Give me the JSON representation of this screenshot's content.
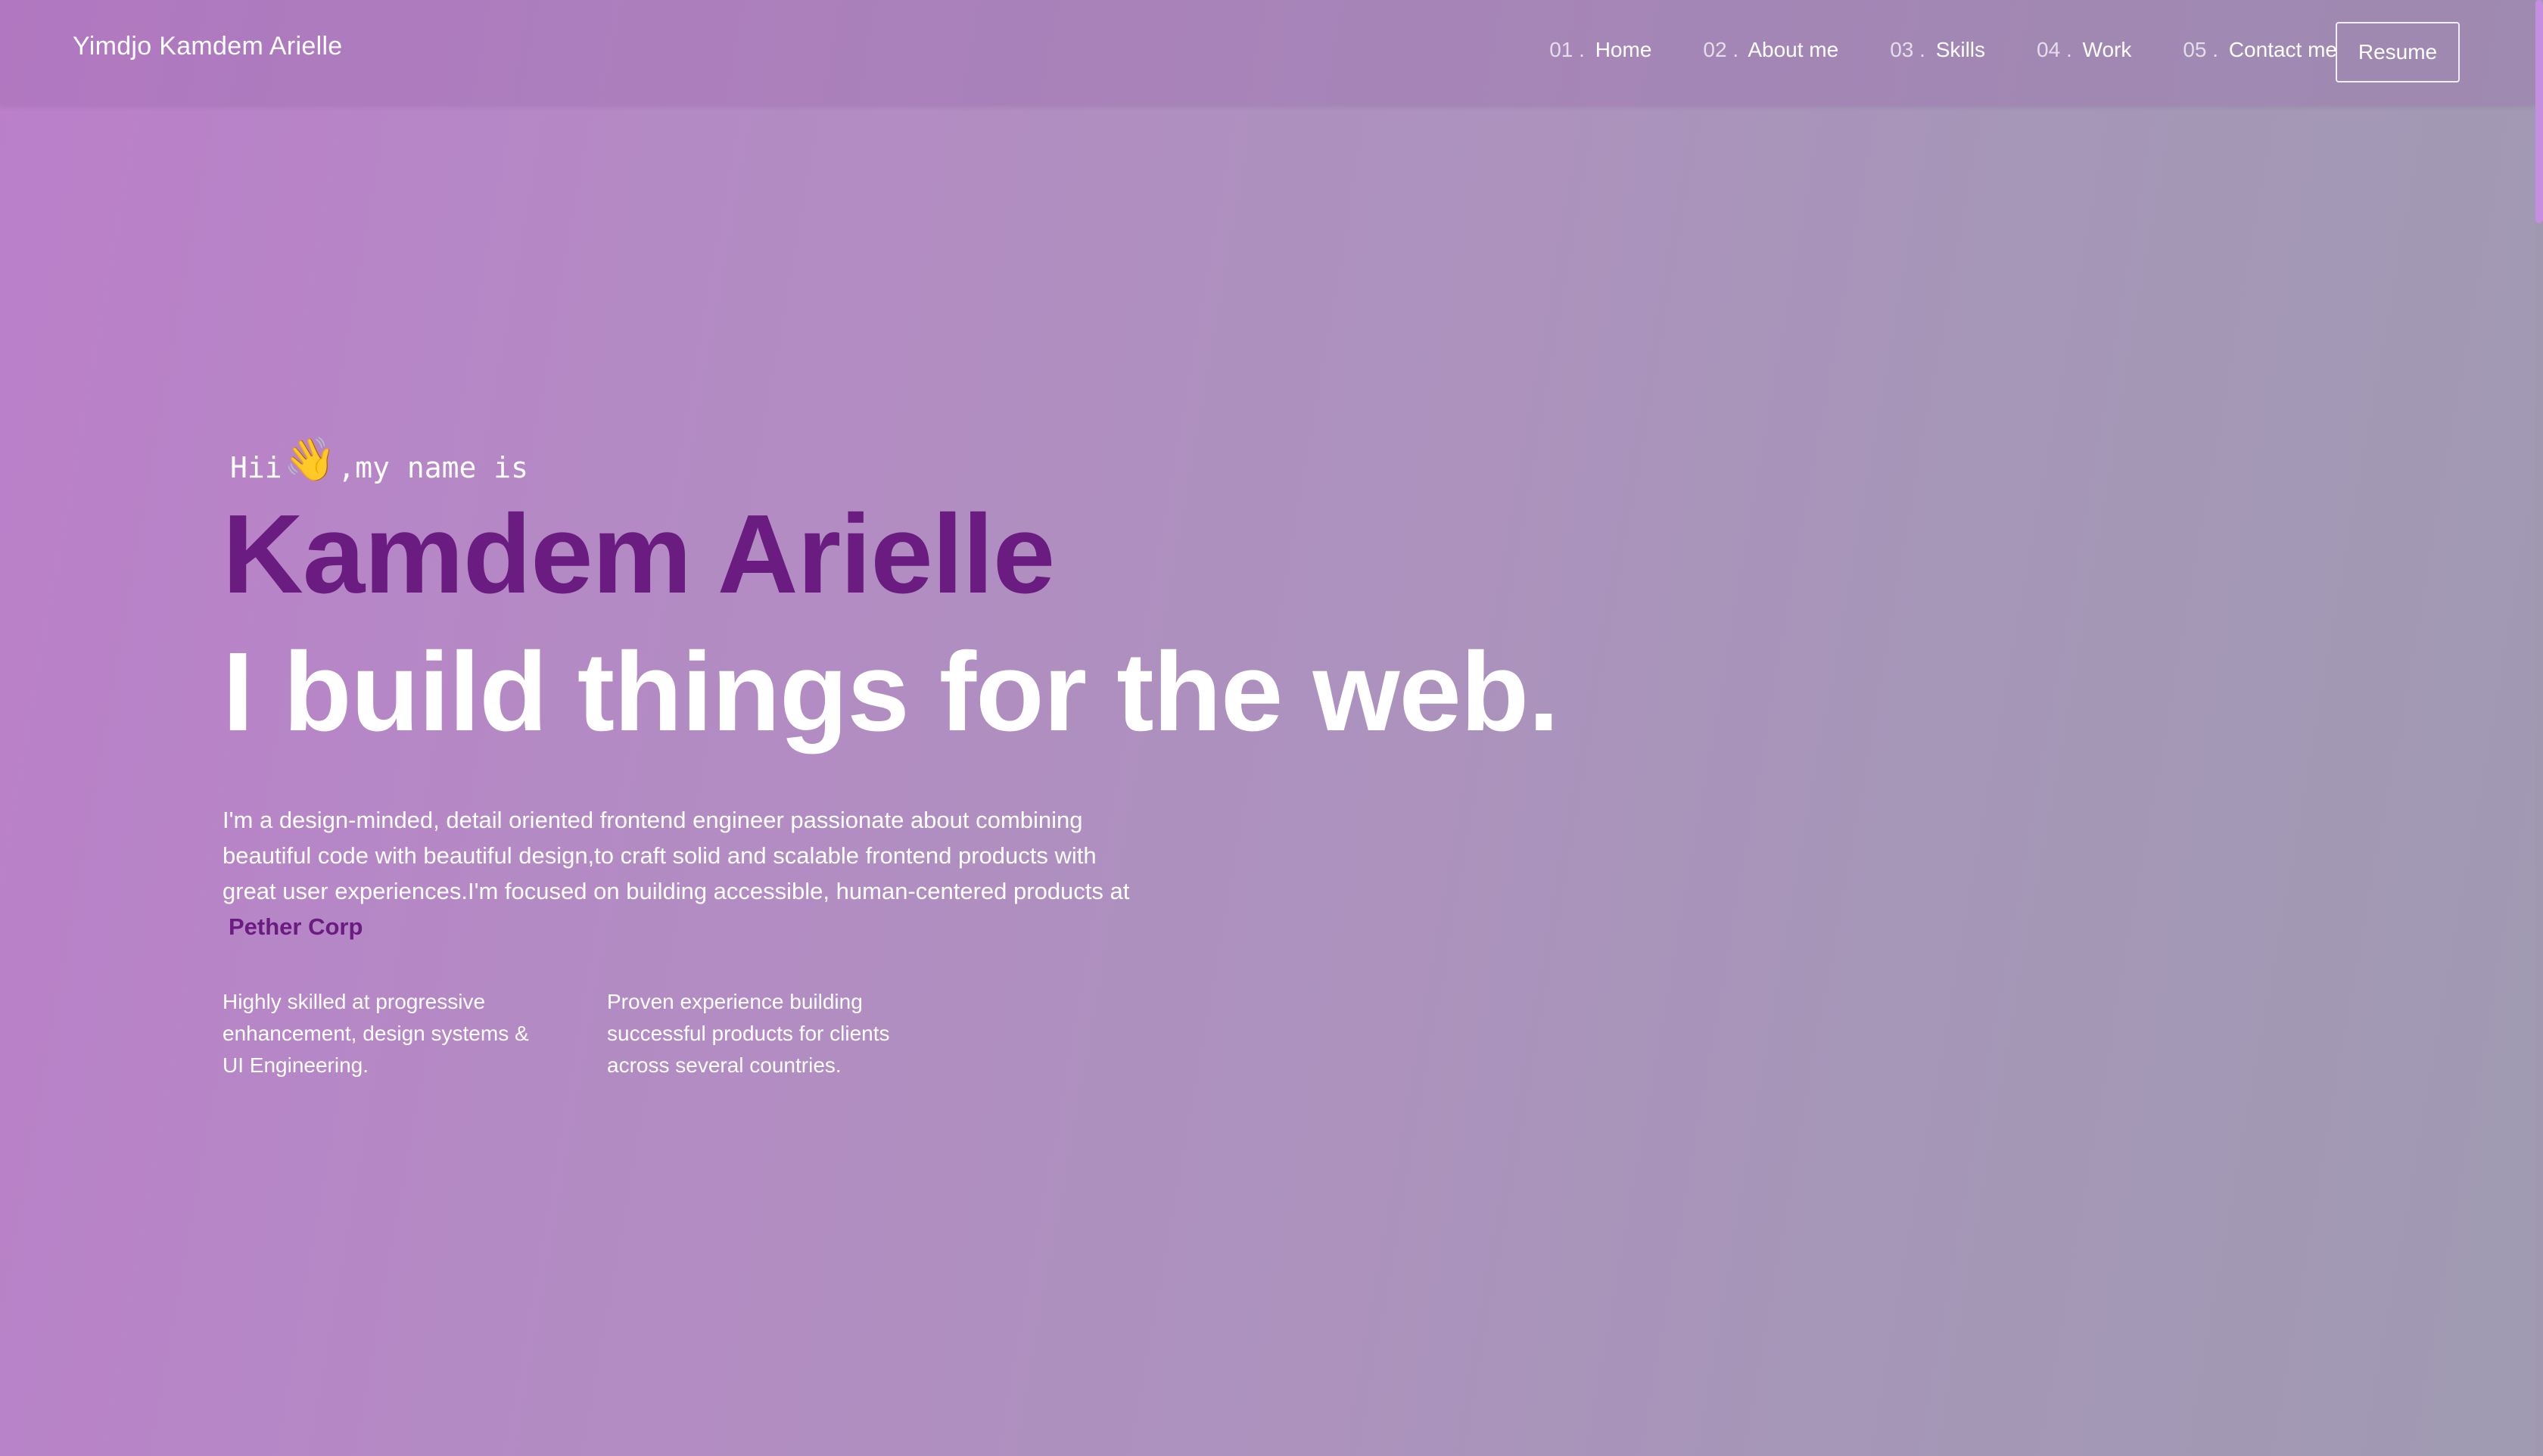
{
  "header": {
    "brand": "Yimdjo Kamdem Arielle",
    "nav": [
      {
        "num": "01 .",
        "label": "Home"
      },
      {
        "num": "02 .",
        "label": "About me"
      },
      {
        "num": "03 .",
        "label": "Skills"
      },
      {
        "num": "04 .",
        "label": "Work"
      },
      {
        "num": "05 .",
        "label": "Contact me"
      }
    ],
    "resume_label": "Resume"
  },
  "hero": {
    "greeting_before": "Hii",
    "wave_icon": "waving-hand-icon",
    "greeting_after": ",my name is",
    "name": "Kamdem Arielle",
    "tagline": "I build things for the web.",
    "intro": "I'm a design-minded, detail oriented frontend engineer passionate about combining beautiful code with beautiful design,to craft solid and scalable frontend products with great user experiences.I'm focused on building accessible, human-centered products at",
    "company": "Pether Corp",
    "features": [
      "Highly skilled at progressive enhancement, design systems & UI Engineering.",
      "Proven experience building successful products for clients across several countries."
    ]
  },
  "colors": {
    "accent": "#6a1c80",
    "text": "#ffffff",
    "scroll_thumb": "#c58ee0"
  }
}
